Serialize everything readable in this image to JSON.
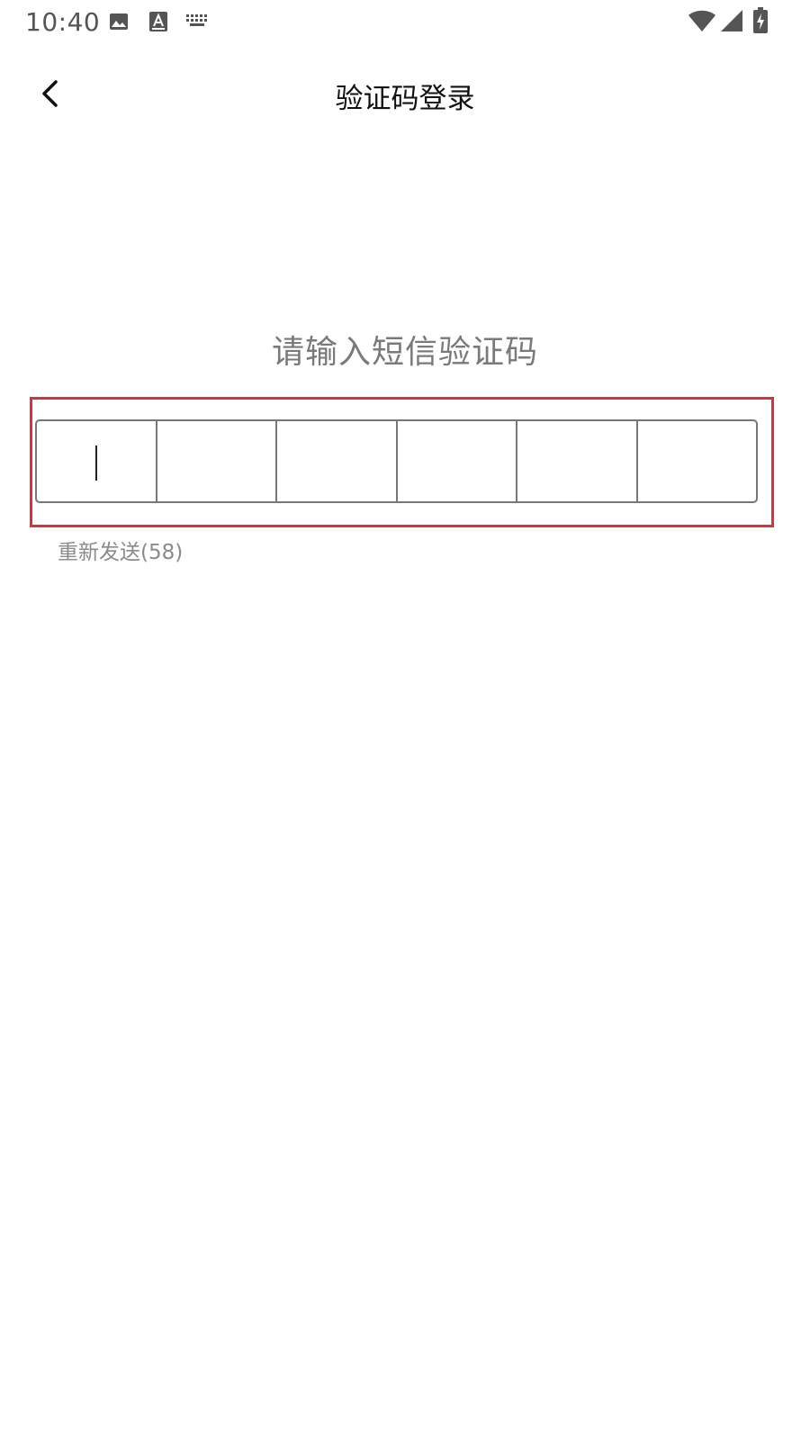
{
  "status_bar": {
    "time": "10:40",
    "notification_icons": [
      "image-icon",
      "text-a-icon",
      "keyboard-icon"
    ],
    "system_icons": [
      "wifi-icon",
      "signal-icon",
      "battery-charging-icon"
    ]
  },
  "app_bar": {
    "back_icon": "chevron-left-icon",
    "title": "验证码登录"
  },
  "main": {
    "prompt": "请输入短信验证码",
    "code_cells": [
      "",
      "",
      "",
      "",
      "",
      ""
    ],
    "resend_label": "重新发送(58)"
  },
  "colors": {
    "highlight": "#d9323a",
    "box_border": "#777777",
    "muted_text": "#8a8a8a"
  }
}
